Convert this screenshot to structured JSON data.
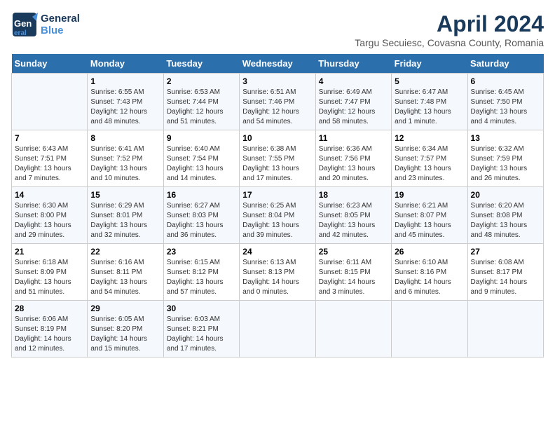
{
  "logo": {
    "general": "General",
    "blue": "Blue"
  },
  "title": "April 2024",
  "subtitle": "Targu Secuiesc, Covasna County, Romania",
  "days_header": [
    "Sunday",
    "Monday",
    "Tuesday",
    "Wednesday",
    "Thursday",
    "Friday",
    "Saturday"
  ],
  "weeks": [
    [
      {
        "num": "",
        "sunrise": "",
        "sunset": "",
        "daylight": ""
      },
      {
        "num": "1",
        "sunrise": "Sunrise: 6:55 AM",
        "sunset": "Sunset: 7:43 PM",
        "daylight": "Daylight: 12 hours and 48 minutes."
      },
      {
        "num": "2",
        "sunrise": "Sunrise: 6:53 AM",
        "sunset": "Sunset: 7:44 PM",
        "daylight": "Daylight: 12 hours and 51 minutes."
      },
      {
        "num": "3",
        "sunrise": "Sunrise: 6:51 AM",
        "sunset": "Sunset: 7:46 PM",
        "daylight": "Daylight: 12 hours and 54 minutes."
      },
      {
        "num": "4",
        "sunrise": "Sunrise: 6:49 AM",
        "sunset": "Sunset: 7:47 PM",
        "daylight": "Daylight: 12 hours and 58 minutes."
      },
      {
        "num": "5",
        "sunrise": "Sunrise: 6:47 AM",
        "sunset": "Sunset: 7:48 PM",
        "daylight": "Daylight: 13 hours and 1 minute."
      },
      {
        "num": "6",
        "sunrise": "Sunrise: 6:45 AM",
        "sunset": "Sunset: 7:50 PM",
        "daylight": "Daylight: 13 hours and 4 minutes."
      }
    ],
    [
      {
        "num": "7",
        "sunrise": "Sunrise: 6:43 AM",
        "sunset": "Sunset: 7:51 PM",
        "daylight": "Daylight: 13 hours and 7 minutes."
      },
      {
        "num": "8",
        "sunrise": "Sunrise: 6:41 AM",
        "sunset": "Sunset: 7:52 PM",
        "daylight": "Daylight: 13 hours and 10 minutes."
      },
      {
        "num": "9",
        "sunrise": "Sunrise: 6:40 AM",
        "sunset": "Sunset: 7:54 PM",
        "daylight": "Daylight: 13 hours and 14 minutes."
      },
      {
        "num": "10",
        "sunrise": "Sunrise: 6:38 AM",
        "sunset": "Sunset: 7:55 PM",
        "daylight": "Daylight: 13 hours and 17 minutes."
      },
      {
        "num": "11",
        "sunrise": "Sunrise: 6:36 AM",
        "sunset": "Sunset: 7:56 PM",
        "daylight": "Daylight: 13 hours and 20 minutes."
      },
      {
        "num": "12",
        "sunrise": "Sunrise: 6:34 AM",
        "sunset": "Sunset: 7:57 PM",
        "daylight": "Daylight: 13 hours and 23 minutes."
      },
      {
        "num": "13",
        "sunrise": "Sunrise: 6:32 AM",
        "sunset": "Sunset: 7:59 PM",
        "daylight": "Daylight: 13 hours and 26 minutes."
      }
    ],
    [
      {
        "num": "14",
        "sunrise": "Sunrise: 6:30 AM",
        "sunset": "Sunset: 8:00 PM",
        "daylight": "Daylight: 13 hours and 29 minutes."
      },
      {
        "num": "15",
        "sunrise": "Sunrise: 6:29 AM",
        "sunset": "Sunset: 8:01 PM",
        "daylight": "Daylight: 13 hours and 32 minutes."
      },
      {
        "num": "16",
        "sunrise": "Sunrise: 6:27 AM",
        "sunset": "Sunset: 8:03 PM",
        "daylight": "Daylight: 13 hours and 36 minutes."
      },
      {
        "num": "17",
        "sunrise": "Sunrise: 6:25 AM",
        "sunset": "Sunset: 8:04 PM",
        "daylight": "Daylight: 13 hours and 39 minutes."
      },
      {
        "num": "18",
        "sunrise": "Sunrise: 6:23 AM",
        "sunset": "Sunset: 8:05 PM",
        "daylight": "Daylight: 13 hours and 42 minutes."
      },
      {
        "num": "19",
        "sunrise": "Sunrise: 6:21 AM",
        "sunset": "Sunset: 8:07 PM",
        "daylight": "Daylight: 13 hours and 45 minutes."
      },
      {
        "num": "20",
        "sunrise": "Sunrise: 6:20 AM",
        "sunset": "Sunset: 8:08 PM",
        "daylight": "Daylight: 13 hours and 48 minutes."
      }
    ],
    [
      {
        "num": "21",
        "sunrise": "Sunrise: 6:18 AM",
        "sunset": "Sunset: 8:09 PM",
        "daylight": "Daylight: 13 hours and 51 minutes."
      },
      {
        "num": "22",
        "sunrise": "Sunrise: 6:16 AM",
        "sunset": "Sunset: 8:11 PM",
        "daylight": "Daylight: 13 hours and 54 minutes."
      },
      {
        "num": "23",
        "sunrise": "Sunrise: 6:15 AM",
        "sunset": "Sunset: 8:12 PM",
        "daylight": "Daylight: 13 hours and 57 minutes."
      },
      {
        "num": "24",
        "sunrise": "Sunrise: 6:13 AM",
        "sunset": "Sunset: 8:13 PM",
        "daylight": "Daylight: 14 hours and 0 minutes."
      },
      {
        "num": "25",
        "sunrise": "Sunrise: 6:11 AM",
        "sunset": "Sunset: 8:15 PM",
        "daylight": "Daylight: 14 hours and 3 minutes."
      },
      {
        "num": "26",
        "sunrise": "Sunrise: 6:10 AM",
        "sunset": "Sunset: 8:16 PM",
        "daylight": "Daylight: 14 hours and 6 minutes."
      },
      {
        "num": "27",
        "sunrise": "Sunrise: 6:08 AM",
        "sunset": "Sunset: 8:17 PM",
        "daylight": "Daylight: 14 hours and 9 minutes."
      }
    ],
    [
      {
        "num": "28",
        "sunrise": "Sunrise: 6:06 AM",
        "sunset": "Sunset: 8:19 PM",
        "daylight": "Daylight: 14 hours and 12 minutes."
      },
      {
        "num": "29",
        "sunrise": "Sunrise: 6:05 AM",
        "sunset": "Sunset: 8:20 PM",
        "daylight": "Daylight: 14 hours and 15 minutes."
      },
      {
        "num": "30",
        "sunrise": "Sunrise: 6:03 AM",
        "sunset": "Sunset: 8:21 PM",
        "daylight": "Daylight: 14 hours and 17 minutes."
      },
      {
        "num": "",
        "sunrise": "",
        "sunset": "",
        "daylight": ""
      },
      {
        "num": "",
        "sunrise": "",
        "sunset": "",
        "daylight": ""
      },
      {
        "num": "",
        "sunrise": "",
        "sunset": "",
        "daylight": ""
      },
      {
        "num": "",
        "sunrise": "",
        "sunset": "",
        "daylight": ""
      }
    ]
  ]
}
